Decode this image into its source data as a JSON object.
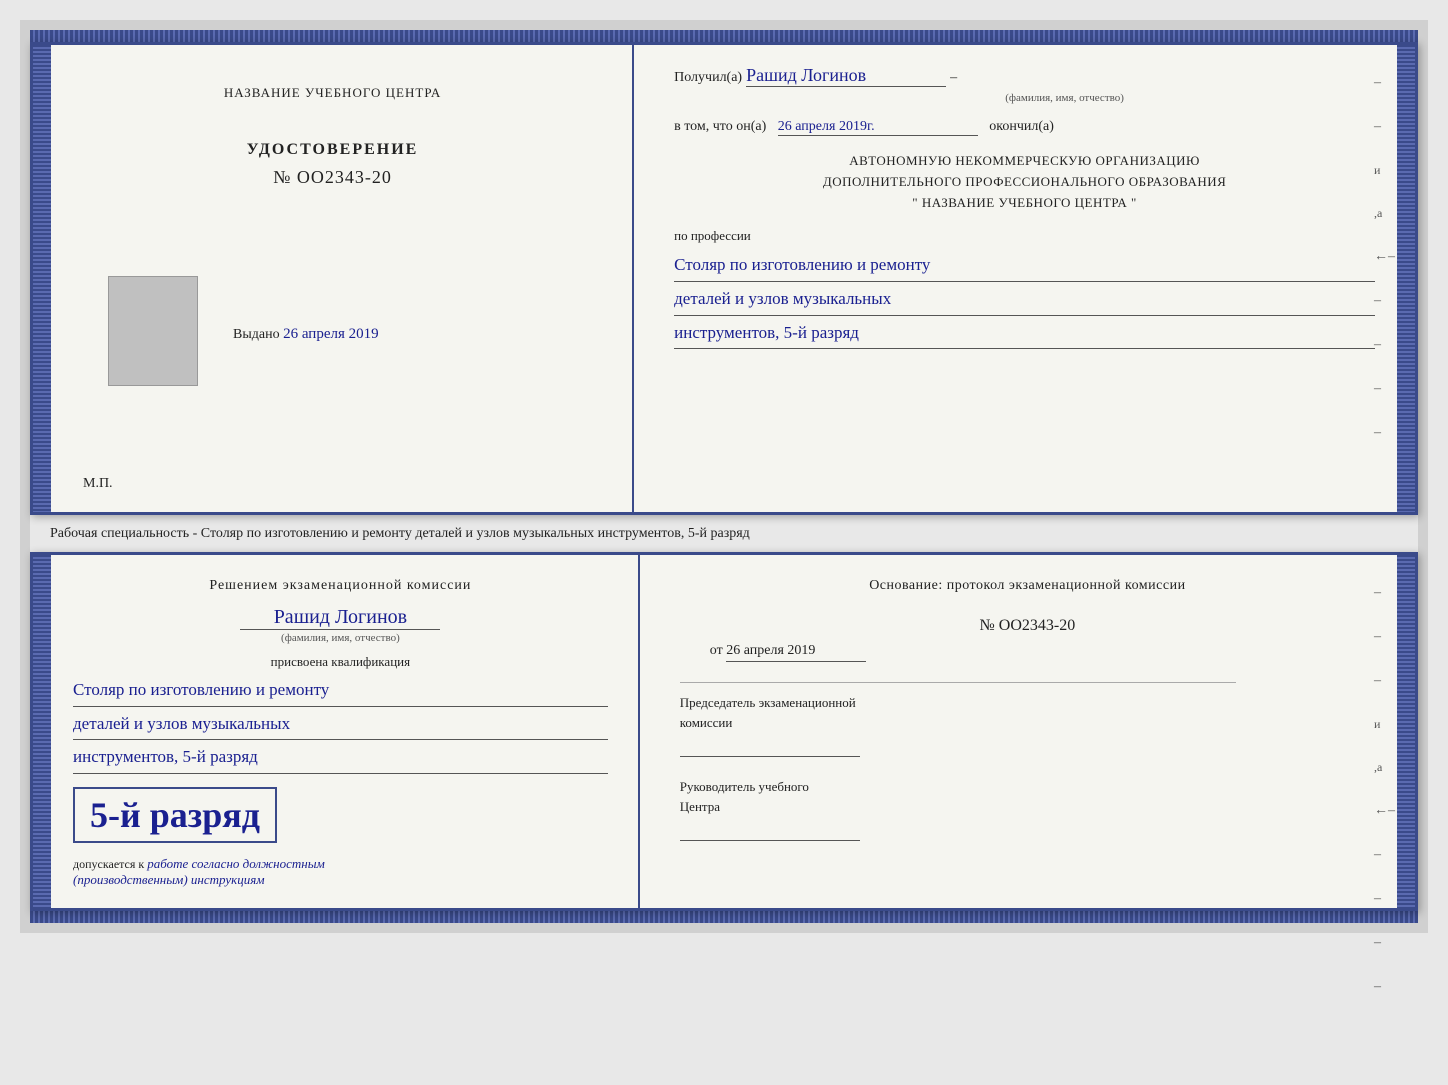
{
  "document": {
    "background_color": "#d0d0d0",
    "top_cert": {
      "left_page": {
        "title": "НАЗВАНИЕ УЧЕБНОГО ЦЕНТРА",
        "cert_label": "УДОСТОВЕРЕНИЕ",
        "cert_number": "№ OO2343-20",
        "issued_label": "Выдано",
        "issued_date": "26 апреля 2019",
        "mp_label": "М.П."
      },
      "right_page": {
        "received_label": "Получил(а)",
        "recipient_name": "Рашид Логинов",
        "name_caption": "(фамилия, имя, отчество)",
        "date_label": "в том, что он(а)",
        "date_value": "26 апреля 2019г.",
        "finished_label": "окончил(а)",
        "org_line1": "АВТОНОМНУЮ НЕКОММЕРЧЕСКУЮ ОРГАНИЗАЦИЮ",
        "org_line2": "ДОПОЛНИТЕЛЬНОГО ПРОФЕССИОНАЛЬНОГО ОБРАЗОВАНИЯ",
        "org_line3": "\"    НАЗВАНИЕ УЧЕБНОГО ЦЕНТРА    \"",
        "profession_label": "по профессии",
        "profession_line1": "Столяр по изготовлению и ремонту",
        "profession_line2": "деталей и узлов музыкальных",
        "profession_line3": "инструментов, 5-й разряд"
      }
    },
    "spec_text": {
      "text": "Рабочая специальность - Столяр по изготовлению и ремонту деталей и узлов музыкальных инструментов, 5-й разряд"
    },
    "bottom_cert": {
      "left_page": {
        "decision_title_line1": "Решением экзаменационной комиссии",
        "recipient_name": "Рашид Логинов",
        "name_caption": "(фамилия, имя, отчество)",
        "qualification_label": "присвоена квалификация",
        "qualification_line1": "Столяр по изготовлению и ремонту",
        "qualification_line2": "деталей и узлов музыкальных",
        "qualification_line3": "инструментов, 5-й разряд",
        "grade_label": "5-й разряд",
        "допускается_label": "допускается к",
        "work_type": "работе согласно должностным",
        "work_type2": "(производственным) инструкциям"
      },
      "right_page": {
        "basis_label": "Основание: протокол экзаменационной комиссии",
        "protocol_number": "№  OO2343-20",
        "date_label": "от",
        "date_value": "26 апреля 2019",
        "chairman_title_line1": "Председатель экзаменационной",
        "chairman_title_line2": "комиссии",
        "head_title_line1": "Руководитель учебного",
        "head_title_line2": "Центра"
      }
    }
  }
}
